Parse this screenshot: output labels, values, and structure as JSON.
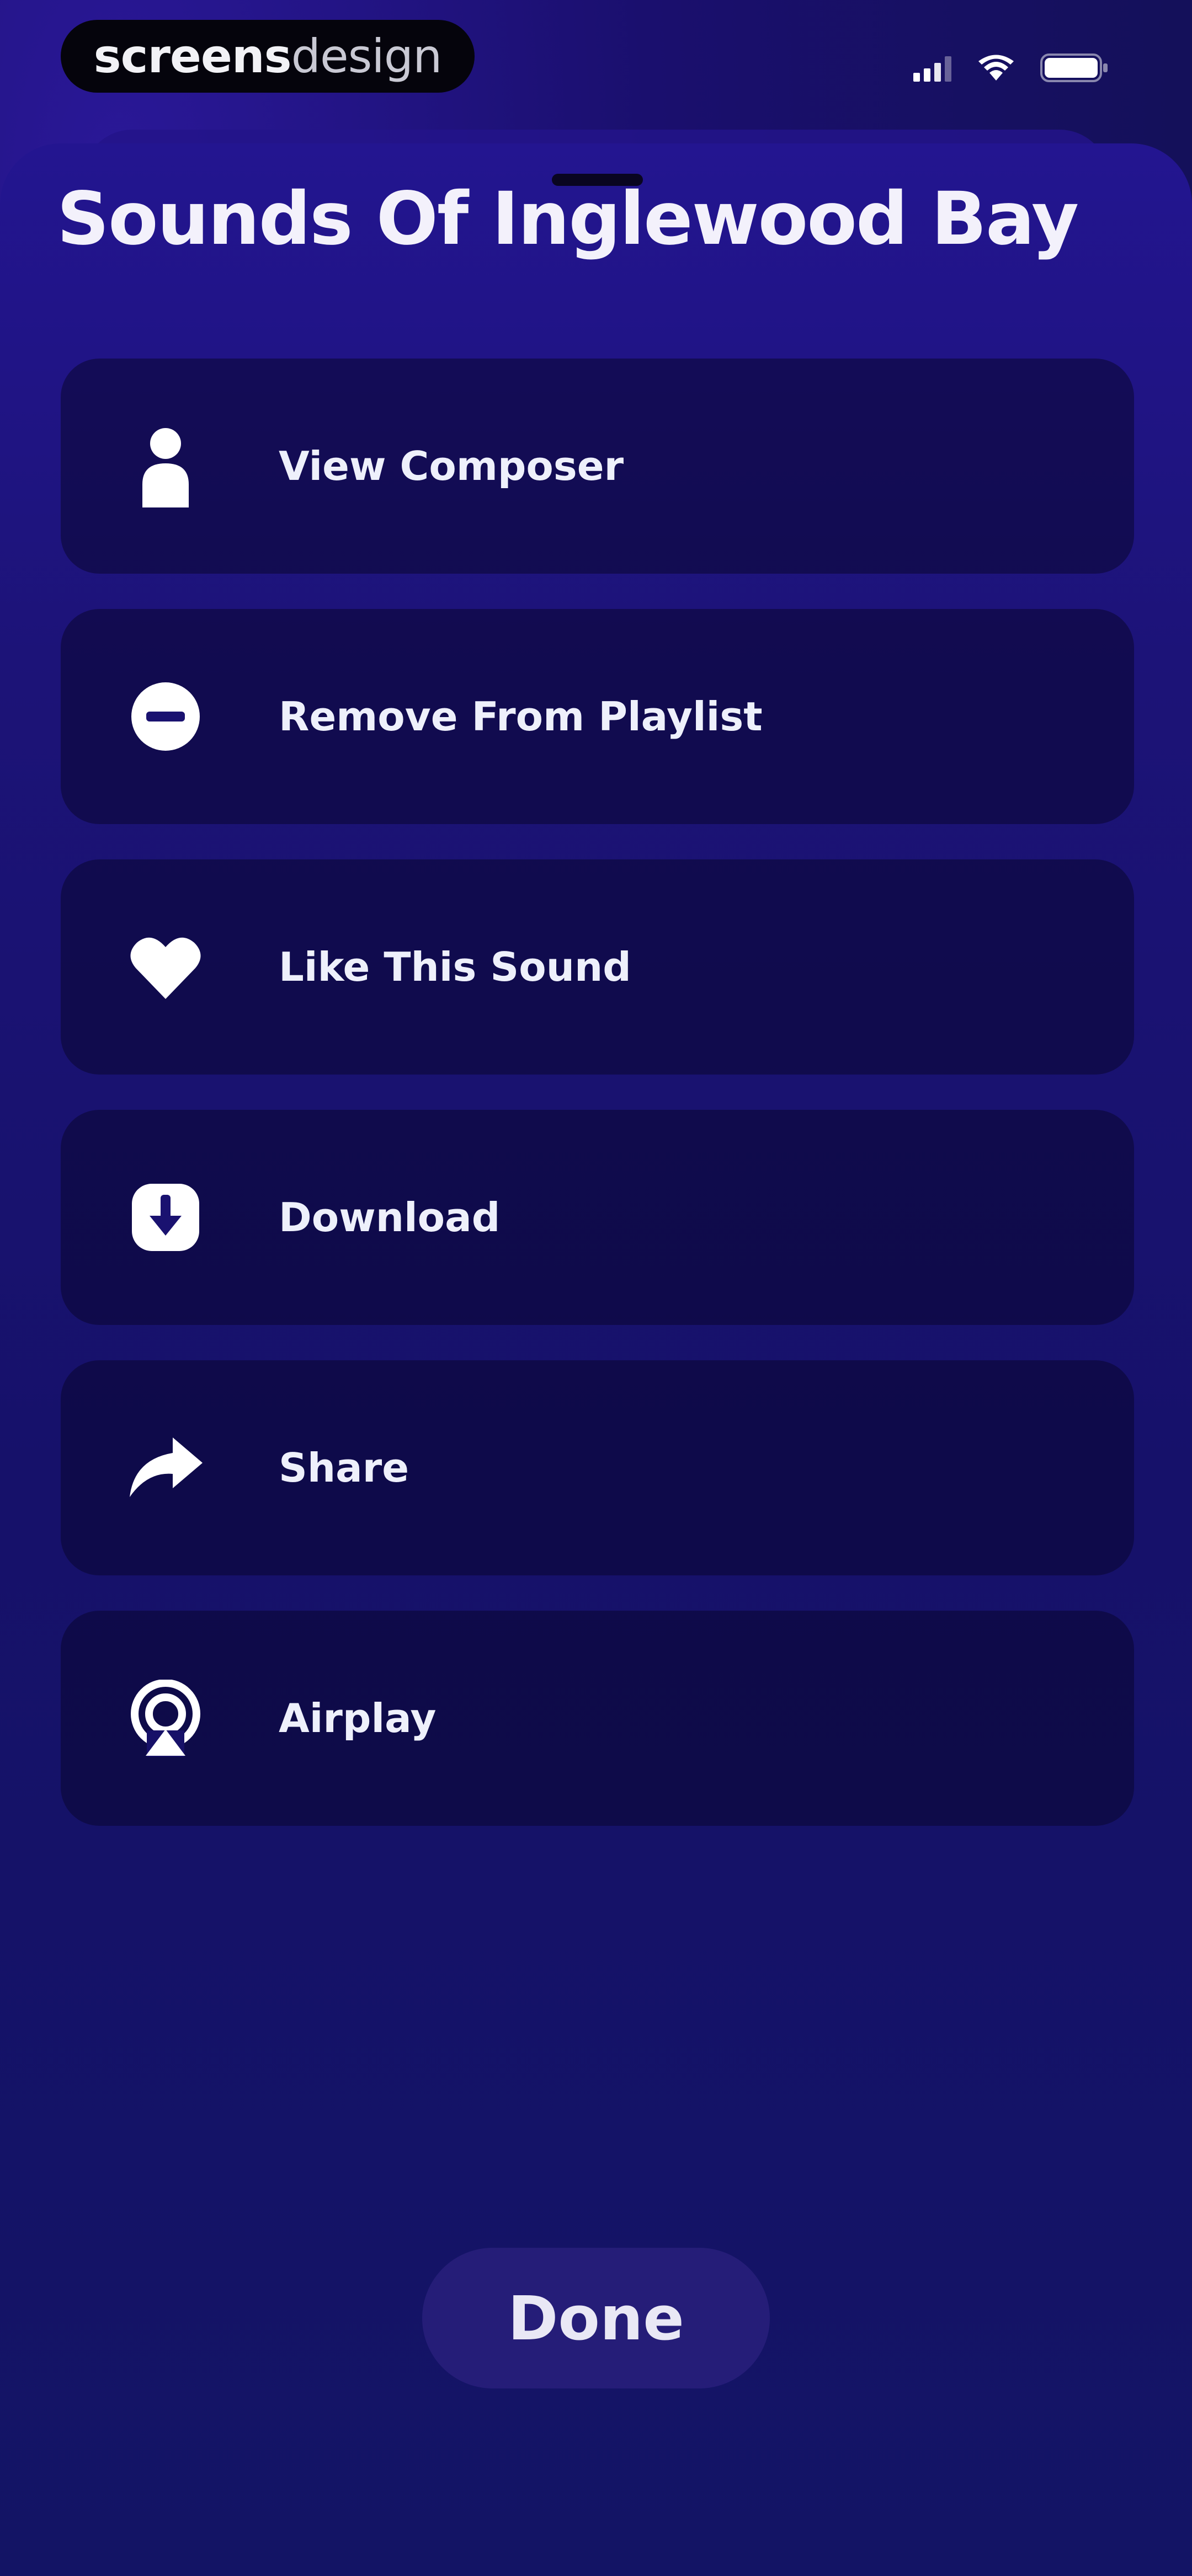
{
  "status_bar": {
    "brand_bold": "screens",
    "brand_light": "design",
    "icons": [
      "signal-icon",
      "wifi-icon",
      "battery-icon"
    ]
  },
  "sheet": {
    "title": "Sounds Of Inglewood Bay",
    "actions": [
      {
        "label": "View Composer",
        "icon": "person-icon"
      },
      {
        "label": "Remove From Playlist",
        "icon": "minus-circle-icon"
      },
      {
        "label": "Like This Sound",
        "icon": "heart-icon"
      },
      {
        "label": "Download",
        "icon": "download-icon"
      },
      {
        "label": "Share",
        "icon": "share-arrow-icon"
      },
      {
        "label": "Airplay",
        "icon": "airplay-icon"
      }
    ],
    "done_label": "Done"
  },
  "colors": {
    "background": "#150a52",
    "sheet": "#1c1377",
    "row": "#0a0630",
    "text": "#eef0fb",
    "done_button": "#251d78"
  }
}
